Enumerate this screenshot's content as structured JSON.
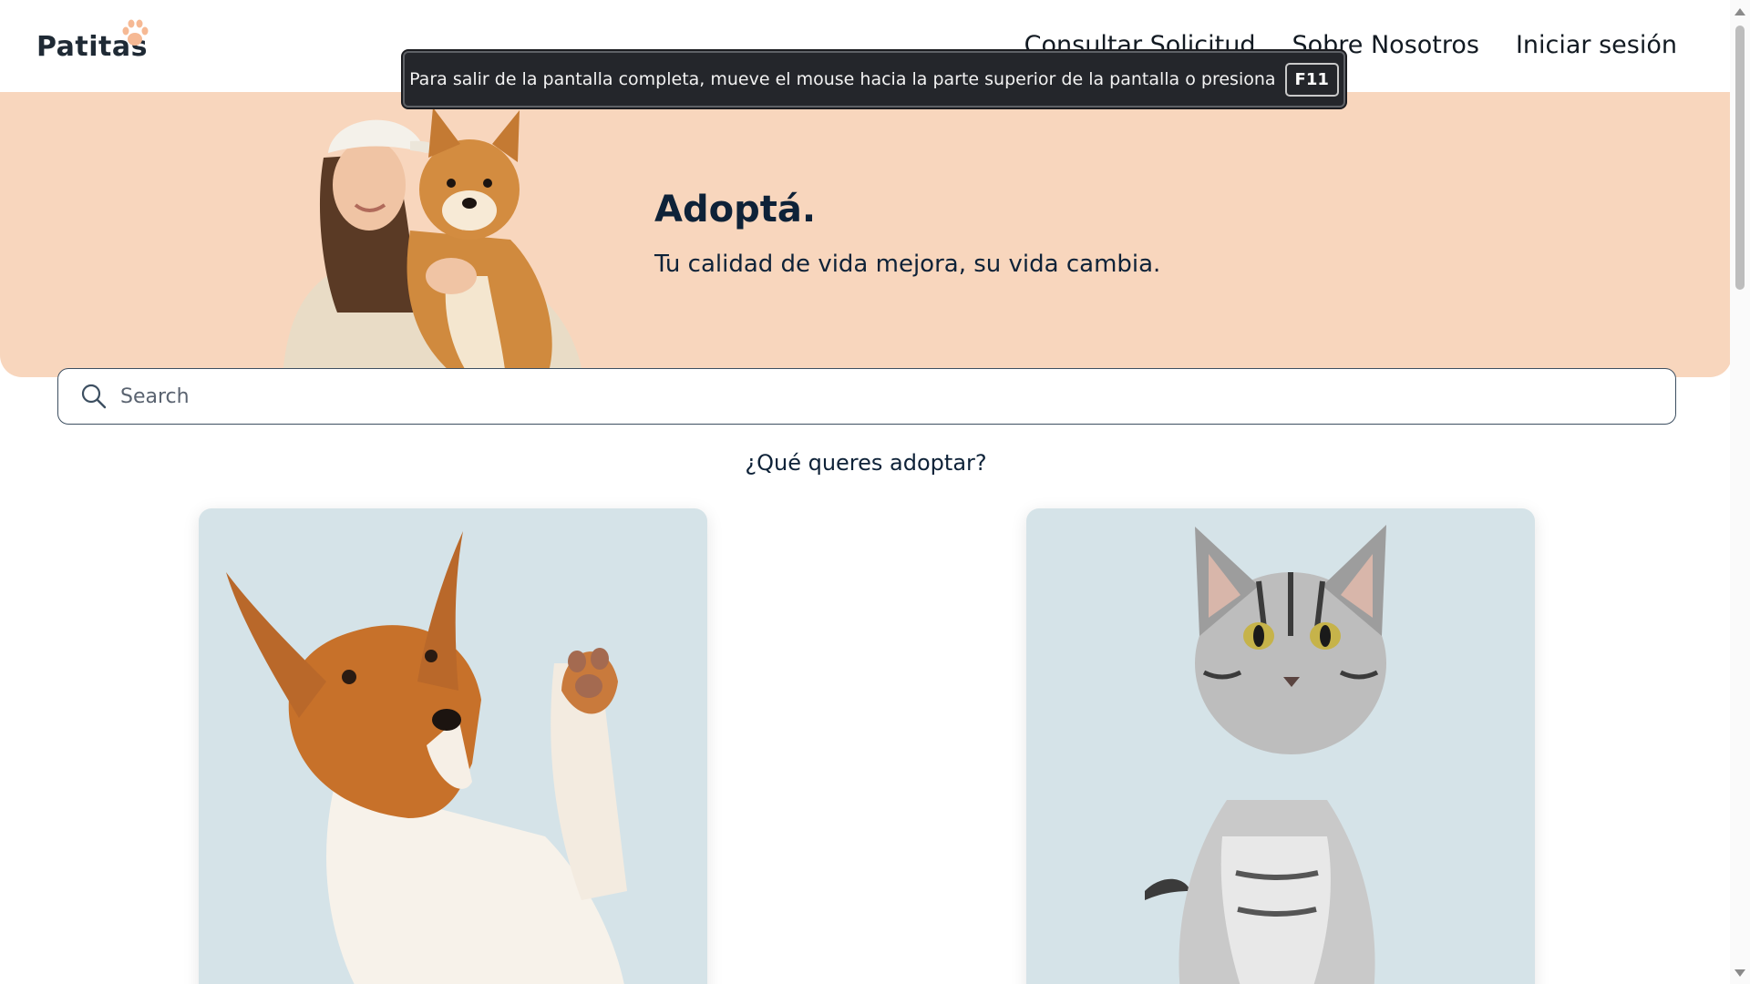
{
  "brand": {
    "name": "Patitas",
    "paw_color": "#f6b994"
  },
  "nav": {
    "items": [
      {
        "label": "Consultar Solicitud"
      },
      {
        "label": "Sobre Nosotros"
      },
      {
        "label": "Iniciar sesión"
      }
    ]
  },
  "fullscreen_toast": {
    "message": "Para salir de la pantalla completa, mueve el mouse hacia la parte superior de la pantalla o presiona",
    "key": "F11"
  },
  "hero": {
    "title": "Adoptá.",
    "subtitle": "Tu calidad de vida mejora, su vida cambia.",
    "background": "#f8d6bd"
  },
  "search": {
    "placeholder": "Search",
    "value": ""
  },
  "section": {
    "question": "¿Qué queres adoptar?"
  },
  "cards": [
    {
      "animal": "dog",
      "icon": "dog-photo"
    },
    {
      "animal": "cat",
      "icon": "cat-photo"
    }
  ],
  "colors": {
    "text": "#0e2238",
    "card_bg": "#d5e3e8"
  }
}
